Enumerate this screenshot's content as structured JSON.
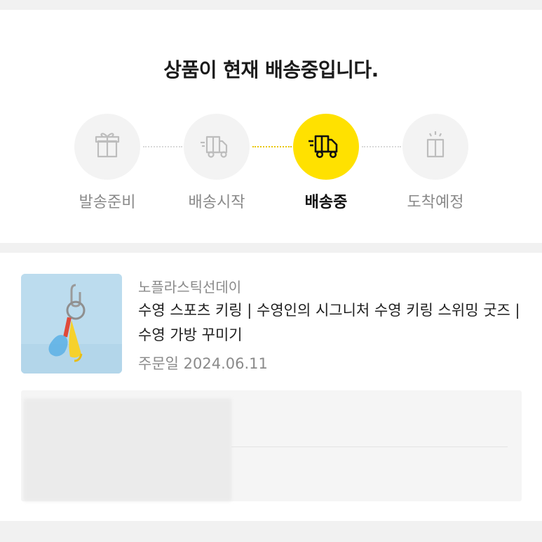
{
  "status": {
    "headline": "상품이 현재 배송중입니다."
  },
  "steps": [
    {
      "label": "발송준비",
      "icon": "gift-icon",
      "active": false
    },
    {
      "label": "배송시작",
      "icon": "truck-icon",
      "active": false
    },
    {
      "label": "배송중",
      "icon": "truck-moving-icon",
      "active": true
    },
    {
      "label": "도착예정",
      "icon": "gift-sparkle-icon",
      "active": false
    }
  ],
  "order": {
    "seller": "노플라스틱선데이",
    "title": "수영 스포츠 키링 | 수영인의 시그니처 수영 키링 스위밍 굿즈 | 수영 가방 꾸미기",
    "date_label": "주문일",
    "date": "2024.06.11"
  },
  "colors": {
    "accent": "#ffe100",
    "muted_text": "#8a8a8a",
    "page_bg": "#f1f1f1"
  }
}
